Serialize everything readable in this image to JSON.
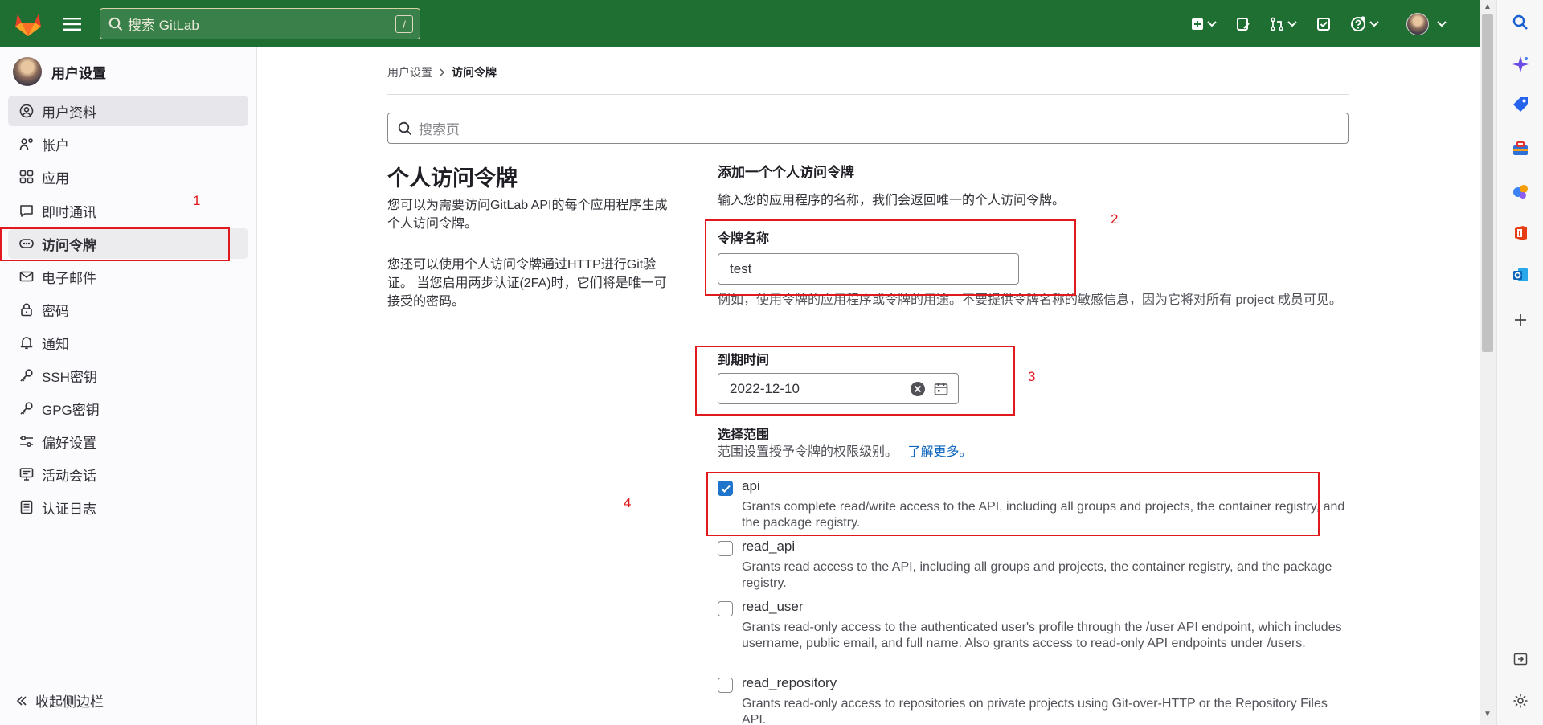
{
  "topbar": {
    "search_placeholder": "搜索 GitLab",
    "search_shortcut": "/",
    "icons": [
      "gitlab-logo",
      "hamburger-icon",
      "plus-square-icon",
      "chevron-down-icon",
      "issues-icon",
      "merge-request-icon",
      "todo-check-icon",
      "help-icon",
      "user-avatar"
    ]
  },
  "sidebar": {
    "title": "用户设置",
    "items": [
      {
        "label": "用户资料",
        "icon": "user-circle-icon"
      },
      {
        "label": "帐户",
        "icon": "account-gear-icon"
      },
      {
        "label": "应用",
        "icon": "applications-grid-icon"
      },
      {
        "label": "即时通讯",
        "icon": "chat-bubble-icon"
      },
      {
        "label": "访问令牌",
        "icon": "token-icon"
      },
      {
        "label": "电子邮件",
        "icon": "mail-icon"
      },
      {
        "label": "密码",
        "icon": "lock-icon"
      },
      {
        "label": "通知",
        "icon": "bell-icon"
      },
      {
        "label": "SSH密钥",
        "icon": "key-icon"
      },
      {
        "label": "GPG密钥",
        "icon": "key-icon"
      },
      {
        "label": "偏好设置",
        "icon": "preferences-icon"
      },
      {
        "label": "活动会话",
        "icon": "monitor-icon"
      },
      {
        "label": "认证日志",
        "icon": "log-list-icon"
      }
    ],
    "collapse_label": "收起侧边栏"
  },
  "breadcrumb": {
    "parent": "用户设置",
    "current": "访问令牌"
  },
  "page_search": {
    "placeholder": "搜索页"
  },
  "intro": {
    "title": "个人访问令牌",
    "p1": "您可以为需要访问GitLab API的每个应用程序生成个人访问令牌。",
    "p2": "您还可以使用个人访问令牌通过HTTP进行Git验证。 当您启用两步认证(2FA)时，它们将是唯一可接受的密码。"
  },
  "form": {
    "title": "添加一个个人访问令牌",
    "subtitle": "输入您的应用程序的名称，我们会返回唯一的个人访问令牌。",
    "token_name_label": "令牌名称",
    "token_name_value": "test",
    "token_name_help": "例如，使用令牌的应用程序或令牌的用途。不要提供令牌名称的敏感信息，因为它将对所有 project 成员可见。",
    "expiry_label": "到期时间",
    "expiry_value": "2022-12-10",
    "scope_label": "选择范围",
    "scope_help": "范围设置授予令牌的权限级别。",
    "scope_help_link": "了解更多。",
    "scopes": [
      {
        "name": "api",
        "checked": true,
        "desc": "Grants complete read/write access to the API, including all groups and projects, the container registry, and the package registry."
      },
      {
        "name": "read_api",
        "checked": false,
        "desc": "Grants read access to the API, including all groups and projects, the container registry, and the package registry."
      },
      {
        "name": "read_user",
        "checked": false,
        "desc": "Grants read-only access to the authenticated user's profile through the /user API endpoint, which includes username, public email, and full name. Also grants access to read-only API endpoints under /users."
      },
      {
        "name": "read_repository",
        "checked": false,
        "desc": "Grants read-only access to repositories on private projects using Git-over-HTTP or the Repository Files API."
      }
    ]
  },
  "annotations": [
    "1",
    "2",
    "3",
    "4"
  ],
  "colors": {
    "topbar": "#1f6f33",
    "annotation": "#e0191e",
    "link": "#1068bf",
    "checkbox": "#1f75cb"
  },
  "browser_sidebar_icons": [
    "search-icon",
    "copilot-sparkle-icon",
    "tag-icon",
    "toolbox-icon",
    "games-icon",
    "office-icon",
    "outlook-icon",
    "plus-icon",
    "sidebar-toggle-icon",
    "settings-icon"
  ]
}
